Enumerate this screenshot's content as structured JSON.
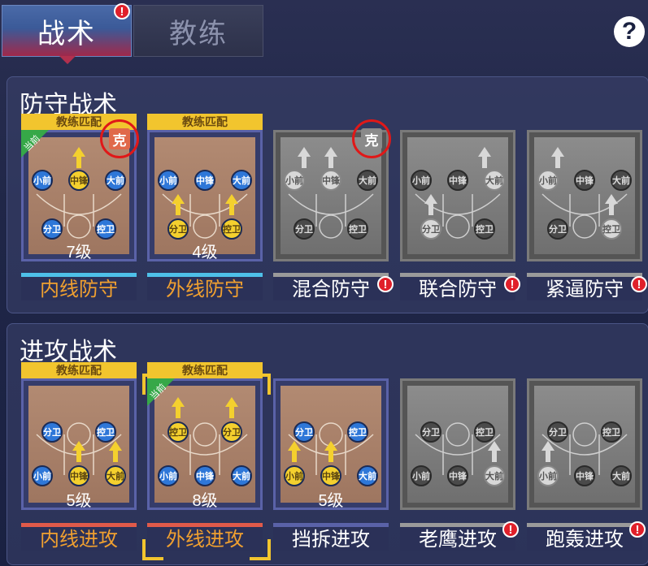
{
  "tabs": [
    {
      "label": "战术",
      "active": true,
      "badge": "!"
    },
    {
      "label": "教练",
      "active": false
    }
  ],
  "help_label": "?",
  "sections": {
    "defense": {
      "title": "防守战术",
      "cards": [
        {
          "name": "内线防守",
          "level": "7级",
          "header": "教练匹配",
          "current": "当前",
          "counter": "克",
          "players": [
            "小前",
            "中锋",
            "大前",
            "分卫",
            "控卫"
          ]
        },
        {
          "name": "外线防守",
          "level": "4级",
          "header": "教练匹配",
          "players": [
            "小前",
            "中锋",
            "大前",
            "分卫",
            "控卫"
          ]
        },
        {
          "name": "混合防守",
          "badge": "!",
          "counter": "克",
          "players": [
            "小前",
            "中锋",
            "大前",
            "分卫",
            "控卫"
          ]
        },
        {
          "name": "联合防守",
          "badge": "!",
          "players": [
            "小前",
            "中锋",
            "大前",
            "分卫",
            "控卫"
          ]
        },
        {
          "name": "紧逼防守",
          "badge": "!",
          "players": [
            "小前",
            "中锋",
            "大前",
            "分卫",
            "控卫"
          ]
        }
      ]
    },
    "offense": {
      "title": "进攻战术",
      "cards": [
        {
          "name": "内线进攻",
          "level": "5级",
          "header": "教练匹配",
          "players": [
            "分卫",
            "控卫",
            "小前",
            "中锋",
            "大前"
          ]
        },
        {
          "name": "外线进攻",
          "level": "8级",
          "header": "教练匹配",
          "current": "当前",
          "players": [
            "控卫",
            "分卫",
            "小前",
            "中锋",
            "大前"
          ]
        },
        {
          "name": "挡拆进攻",
          "level": "5级",
          "players": [
            "分卫",
            "控卫",
            "小前",
            "中锋",
            "大前"
          ]
        },
        {
          "name": "老鹰进攻",
          "badge": "!",
          "players": [
            "分卫",
            "控卫",
            "小前",
            "中锋",
            "大前"
          ]
        },
        {
          "name": "跑轰进攻",
          "badge": "!",
          "players": [
            "分卫",
            "控卫",
            "小前",
            "中锋",
            "大前"
          ]
        }
      ]
    }
  },
  "colors": {
    "active_name": "#f0a030",
    "inactive_name": "#ffffff",
    "badge": "#e0202a",
    "header": "#f2c52e"
  }
}
